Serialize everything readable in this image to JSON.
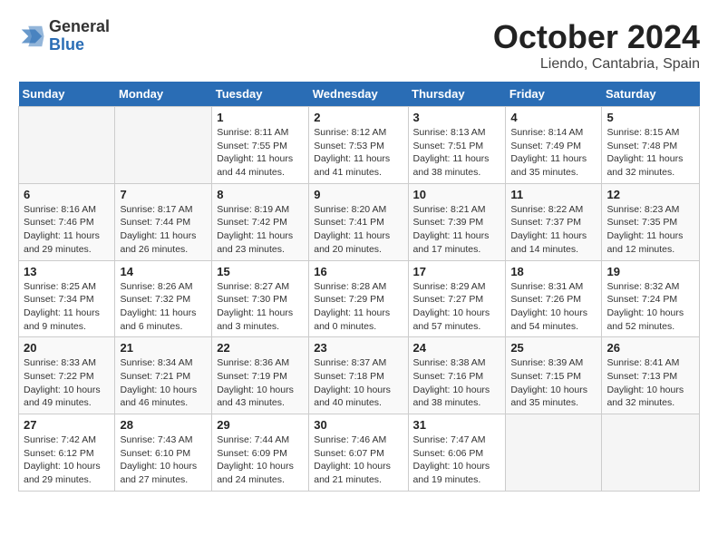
{
  "header": {
    "logo_general": "General",
    "logo_blue": "Blue",
    "month_title": "October 2024",
    "location": "Liendo, Cantabria, Spain"
  },
  "weekdays": [
    "Sunday",
    "Monday",
    "Tuesday",
    "Wednesday",
    "Thursday",
    "Friday",
    "Saturday"
  ],
  "weeks": [
    [
      {
        "day": "",
        "sunrise": "",
        "sunset": "",
        "daylight": ""
      },
      {
        "day": "",
        "sunrise": "",
        "sunset": "",
        "daylight": ""
      },
      {
        "day": "1",
        "sunrise": "Sunrise: 8:11 AM",
        "sunset": "Sunset: 7:55 PM",
        "daylight": "Daylight: 11 hours and 44 minutes."
      },
      {
        "day": "2",
        "sunrise": "Sunrise: 8:12 AM",
        "sunset": "Sunset: 7:53 PM",
        "daylight": "Daylight: 11 hours and 41 minutes."
      },
      {
        "day": "3",
        "sunrise": "Sunrise: 8:13 AM",
        "sunset": "Sunset: 7:51 PM",
        "daylight": "Daylight: 11 hours and 38 minutes."
      },
      {
        "day": "4",
        "sunrise": "Sunrise: 8:14 AM",
        "sunset": "Sunset: 7:49 PM",
        "daylight": "Daylight: 11 hours and 35 minutes."
      },
      {
        "day": "5",
        "sunrise": "Sunrise: 8:15 AM",
        "sunset": "Sunset: 7:48 PM",
        "daylight": "Daylight: 11 hours and 32 minutes."
      }
    ],
    [
      {
        "day": "6",
        "sunrise": "Sunrise: 8:16 AM",
        "sunset": "Sunset: 7:46 PM",
        "daylight": "Daylight: 11 hours and 29 minutes."
      },
      {
        "day": "7",
        "sunrise": "Sunrise: 8:17 AM",
        "sunset": "Sunset: 7:44 PM",
        "daylight": "Daylight: 11 hours and 26 minutes."
      },
      {
        "day": "8",
        "sunrise": "Sunrise: 8:19 AM",
        "sunset": "Sunset: 7:42 PM",
        "daylight": "Daylight: 11 hours and 23 minutes."
      },
      {
        "day": "9",
        "sunrise": "Sunrise: 8:20 AM",
        "sunset": "Sunset: 7:41 PM",
        "daylight": "Daylight: 11 hours and 20 minutes."
      },
      {
        "day": "10",
        "sunrise": "Sunrise: 8:21 AM",
        "sunset": "Sunset: 7:39 PM",
        "daylight": "Daylight: 11 hours and 17 minutes."
      },
      {
        "day": "11",
        "sunrise": "Sunrise: 8:22 AM",
        "sunset": "Sunset: 7:37 PM",
        "daylight": "Daylight: 11 hours and 14 minutes."
      },
      {
        "day": "12",
        "sunrise": "Sunrise: 8:23 AM",
        "sunset": "Sunset: 7:35 PM",
        "daylight": "Daylight: 11 hours and 12 minutes."
      }
    ],
    [
      {
        "day": "13",
        "sunrise": "Sunrise: 8:25 AM",
        "sunset": "Sunset: 7:34 PM",
        "daylight": "Daylight: 11 hours and 9 minutes."
      },
      {
        "day": "14",
        "sunrise": "Sunrise: 8:26 AM",
        "sunset": "Sunset: 7:32 PM",
        "daylight": "Daylight: 11 hours and 6 minutes."
      },
      {
        "day": "15",
        "sunrise": "Sunrise: 8:27 AM",
        "sunset": "Sunset: 7:30 PM",
        "daylight": "Daylight: 11 hours and 3 minutes."
      },
      {
        "day": "16",
        "sunrise": "Sunrise: 8:28 AM",
        "sunset": "Sunset: 7:29 PM",
        "daylight": "Daylight: 11 hours and 0 minutes."
      },
      {
        "day": "17",
        "sunrise": "Sunrise: 8:29 AM",
        "sunset": "Sunset: 7:27 PM",
        "daylight": "Daylight: 10 hours and 57 minutes."
      },
      {
        "day": "18",
        "sunrise": "Sunrise: 8:31 AM",
        "sunset": "Sunset: 7:26 PM",
        "daylight": "Daylight: 10 hours and 54 minutes."
      },
      {
        "day": "19",
        "sunrise": "Sunrise: 8:32 AM",
        "sunset": "Sunset: 7:24 PM",
        "daylight": "Daylight: 10 hours and 52 minutes."
      }
    ],
    [
      {
        "day": "20",
        "sunrise": "Sunrise: 8:33 AM",
        "sunset": "Sunset: 7:22 PM",
        "daylight": "Daylight: 10 hours and 49 minutes."
      },
      {
        "day": "21",
        "sunrise": "Sunrise: 8:34 AM",
        "sunset": "Sunset: 7:21 PM",
        "daylight": "Daylight: 10 hours and 46 minutes."
      },
      {
        "day": "22",
        "sunrise": "Sunrise: 8:36 AM",
        "sunset": "Sunset: 7:19 PM",
        "daylight": "Daylight: 10 hours and 43 minutes."
      },
      {
        "day": "23",
        "sunrise": "Sunrise: 8:37 AM",
        "sunset": "Sunset: 7:18 PM",
        "daylight": "Daylight: 10 hours and 40 minutes."
      },
      {
        "day": "24",
        "sunrise": "Sunrise: 8:38 AM",
        "sunset": "Sunset: 7:16 PM",
        "daylight": "Daylight: 10 hours and 38 minutes."
      },
      {
        "day": "25",
        "sunrise": "Sunrise: 8:39 AM",
        "sunset": "Sunset: 7:15 PM",
        "daylight": "Daylight: 10 hours and 35 minutes."
      },
      {
        "day": "26",
        "sunrise": "Sunrise: 8:41 AM",
        "sunset": "Sunset: 7:13 PM",
        "daylight": "Daylight: 10 hours and 32 minutes."
      }
    ],
    [
      {
        "day": "27",
        "sunrise": "Sunrise: 7:42 AM",
        "sunset": "Sunset: 6:12 PM",
        "daylight": "Daylight: 10 hours and 29 minutes."
      },
      {
        "day": "28",
        "sunrise": "Sunrise: 7:43 AM",
        "sunset": "Sunset: 6:10 PM",
        "daylight": "Daylight: 10 hours and 27 minutes."
      },
      {
        "day": "29",
        "sunrise": "Sunrise: 7:44 AM",
        "sunset": "Sunset: 6:09 PM",
        "daylight": "Daylight: 10 hours and 24 minutes."
      },
      {
        "day": "30",
        "sunrise": "Sunrise: 7:46 AM",
        "sunset": "Sunset: 6:07 PM",
        "daylight": "Daylight: 10 hours and 21 minutes."
      },
      {
        "day": "31",
        "sunrise": "Sunrise: 7:47 AM",
        "sunset": "Sunset: 6:06 PM",
        "daylight": "Daylight: 10 hours and 19 minutes."
      },
      {
        "day": "",
        "sunrise": "",
        "sunset": "",
        "daylight": ""
      },
      {
        "day": "",
        "sunrise": "",
        "sunset": "",
        "daylight": ""
      }
    ]
  ]
}
